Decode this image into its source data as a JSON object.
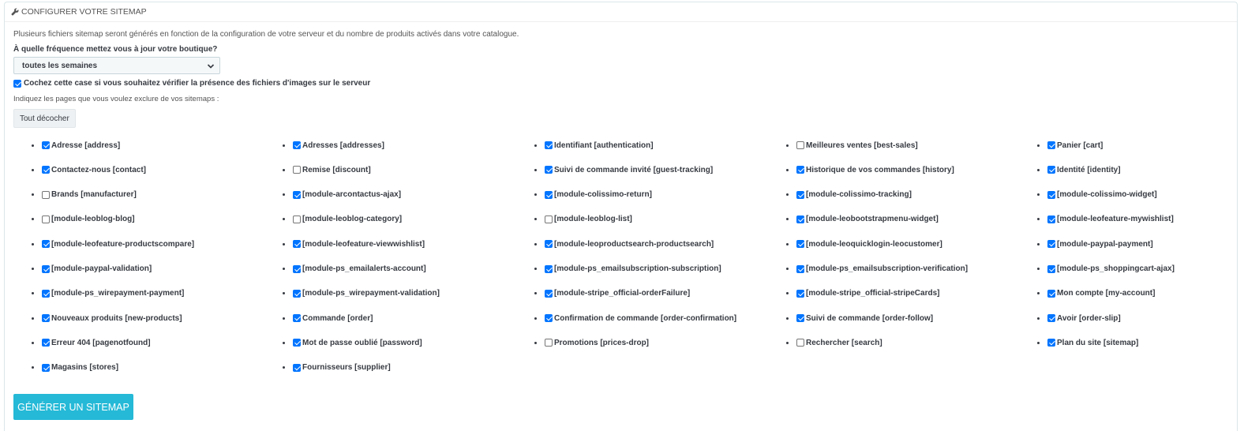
{
  "panel": {
    "title": "CONFIGURER VOTRE SITEMAP"
  },
  "intro": "Plusieurs fichiers sitemap seront générés en fonction de la configuration de votre serveur et du nombre de produits activés dans votre catalogue.",
  "frequency": {
    "label": "À quelle fréquence mettez vous à jour votre boutique?",
    "selected": "toutes les semaines"
  },
  "image_check": {
    "label": "Cochez cette case si vous souhaitez vérifier la présence des fichiers d'images sur le serveur",
    "checked": true
  },
  "exclude_label": "Indiquez les pages que vous voulez exclure de vos sitemaps :",
  "uncheck_all_label": "Tout décocher",
  "pages": [
    {
      "label": "Adresse [address]",
      "checked": true
    },
    {
      "label": "Adresses [addresses]",
      "checked": true
    },
    {
      "label": "Identifiant [authentication]",
      "checked": true
    },
    {
      "label": "Meilleures ventes [best-sales]",
      "checked": false
    },
    {
      "label": "Panier [cart]",
      "checked": true
    },
    {
      "label": "Contactez-nous [contact]",
      "checked": true
    },
    {
      "label": "Remise [discount]",
      "checked": false
    },
    {
      "label": "Suivi de commande invité [guest-tracking]",
      "checked": true
    },
    {
      "label": "Historique de vos commandes [history]",
      "checked": true
    },
    {
      "label": "Identité [identity]",
      "checked": true
    },
    {
      "label": "Brands [manufacturer]",
      "checked": false
    },
    {
      "label": "[module-arcontactus-ajax]",
      "checked": true
    },
    {
      "label": "[module-colissimo-return]",
      "checked": true
    },
    {
      "label": "[module-colissimo-tracking]",
      "checked": true
    },
    {
      "label": "[module-colissimo-widget]",
      "checked": true
    },
    {
      "label": "[module-leoblog-blog]",
      "checked": false
    },
    {
      "label": "[module-leoblog-category]",
      "checked": false
    },
    {
      "label": "[module-leoblog-list]",
      "checked": false
    },
    {
      "label": "[module-leobootstrapmenu-widget]",
      "checked": true
    },
    {
      "label": "[module-leofeature-mywishlist]",
      "checked": true
    },
    {
      "label": "[module-leofeature-productscompare]",
      "checked": true
    },
    {
      "label": "[module-leofeature-viewwishlist]",
      "checked": true
    },
    {
      "label": "[module-leoproductsearch-productsearch]",
      "checked": true
    },
    {
      "label": "[module-leoquicklogin-leocustomer]",
      "checked": true
    },
    {
      "label": "[module-paypal-payment]",
      "checked": true
    },
    {
      "label": "[module-paypal-validation]",
      "checked": true
    },
    {
      "label": "[module-ps_emailalerts-account]",
      "checked": true
    },
    {
      "label": "[module-ps_emailsubscription-subscription]",
      "checked": true
    },
    {
      "label": "[module-ps_emailsubscription-verification]",
      "checked": true
    },
    {
      "label": "[module-ps_shoppingcart-ajax]",
      "checked": true
    },
    {
      "label": "[module-ps_wirepayment-payment]",
      "checked": true
    },
    {
      "label": "[module-ps_wirepayment-validation]",
      "checked": true
    },
    {
      "label": "[module-stripe_official-orderFailure]",
      "checked": true
    },
    {
      "label": "[module-stripe_official-stripeCards]",
      "checked": true
    },
    {
      "label": "Mon compte [my-account]",
      "checked": true
    },
    {
      "label": "Nouveaux produits [new-products]",
      "checked": true
    },
    {
      "label": "Commande [order]",
      "checked": true
    },
    {
      "label": "Confirmation de commande [order-confirmation]",
      "checked": true
    },
    {
      "label": "Suivi de commande [order-follow]",
      "checked": true
    },
    {
      "label": "Avoir [order-slip]",
      "checked": true
    },
    {
      "label": "Erreur 404 [pagenotfound]",
      "checked": true
    },
    {
      "label": "Mot de passe oublié [password]",
      "checked": true
    },
    {
      "label": "Promotions [prices-drop]",
      "checked": false
    },
    {
      "label": "Rechercher [search]",
      "checked": false
    },
    {
      "label": "Plan du site [sitemap]",
      "checked": true
    },
    {
      "label": "Magasins [stores]",
      "checked": true
    },
    {
      "label": "Fournisseurs [supplier]",
      "checked": true
    }
  ],
  "generate_label": "GÉNÉRER UN SITEMAP",
  "colors": {
    "primary": "#25b9d7",
    "checkbox": "#0075ff"
  }
}
